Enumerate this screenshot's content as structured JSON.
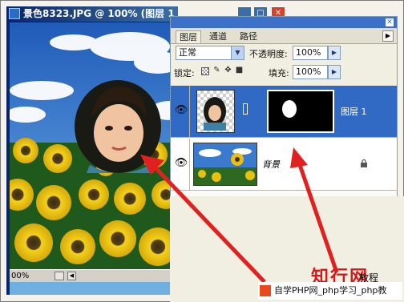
{
  "document": {
    "title": "景色8323.JPG @ 100% (图层 1",
    "zoom": "00%"
  },
  "panel": {
    "tabs": [
      "图层",
      "通道",
      "路径"
    ],
    "blend_mode": "正常",
    "opacity_label": "不透明度:",
    "opacity_value": "100%",
    "lock_label": "锁定:",
    "fill_label": "填充:",
    "fill_value": "100%",
    "layers": [
      {
        "name": "图层 1",
        "selected": true,
        "has_mask": true
      },
      {
        "name": "背景",
        "selected": false,
        "locked": true
      }
    ]
  },
  "watermark": {
    "big_text": "知行网",
    "small_text": "教程",
    "banner_text": "自学PHP网_php学习_php教"
  },
  "colors": {
    "titlebar": "#0a246a",
    "selected_layer": "#316ac5",
    "arrow": "#e0211f",
    "panel_bg": "#f1efe2"
  }
}
